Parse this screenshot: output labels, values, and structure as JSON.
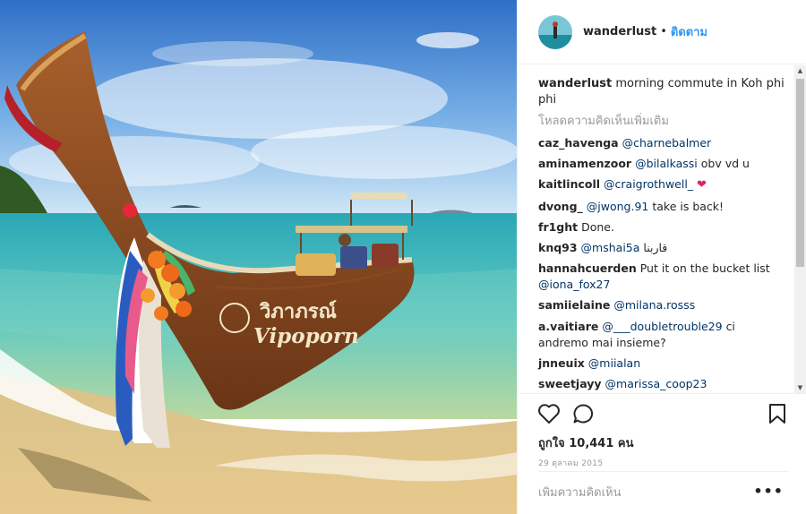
{
  "post": {
    "username": "wanderlust",
    "separator": "•",
    "follow_label": "ติดตาม",
    "caption": {
      "username": "wanderlust",
      "text": "morning commute in Koh phi phi"
    },
    "load_more_label": "โหลดความคิดเห็นเพิ่มเติม",
    "comments": [
      {
        "user": "caz_havenga",
        "mention": "@charnebalmer",
        "text": ""
      },
      {
        "user": "aminamenzoor",
        "mention": "@bilalkassi",
        "text": "obv vd u"
      },
      {
        "user": "kaitlincoll",
        "mention": "@craigrothwell_",
        "text": "",
        "emoji": "heart"
      },
      {
        "user": "dvong_",
        "mention": "@jwong.91",
        "text": "take is back!"
      },
      {
        "user": "fr1ght",
        "mention": "",
        "text": "Done."
      },
      {
        "user": "knq93",
        "mention": "@mshai5a",
        "text": "قاربنا"
      },
      {
        "user": "hannahcuerden",
        "mention": "",
        "text": "Put it on the bucket list",
        "mention_after": "@iona_fox27"
      },
      {
        "user": "samiielaine",
        "mention": "@milana.rosss",
        "text": ""
      },
      {
        "user": "a.vaitiare",
        "mention": "@___doubletrouble29",
        "text": "ci andremo mai insieme?"
      },
      {
        "user": "jnneuix",
        "mention": "@miialan",
        "text": ""
      },
      {
        "user": "sweetjayy",
        "mention": "@marissa_coop23",
        "text": ""
      }
    ],
    "likes_label": "ถูกใจ 10,441 คน",
    "date_label": "29 ตุลาคม 2015",
    "add_comment_placeholder": "เพิ่มความคิดเห็น",
    "more_label": "•••",
    "boat_name_thai": "วิภาภรณ์",
    "boat_name_latin": "Vipoporn"
  },
  "icons": {
    "like": "heart-icon",
    "comment": "speech-bubble-icon",
    "save": "bookmark-icon",
    "more": "more-options-icon"
  },
  "colors": {
    "link": "#3897f0",
    "mention": "#003569",
    "muted": "#999999",
    "heart": "#e0245e"
  }
}
